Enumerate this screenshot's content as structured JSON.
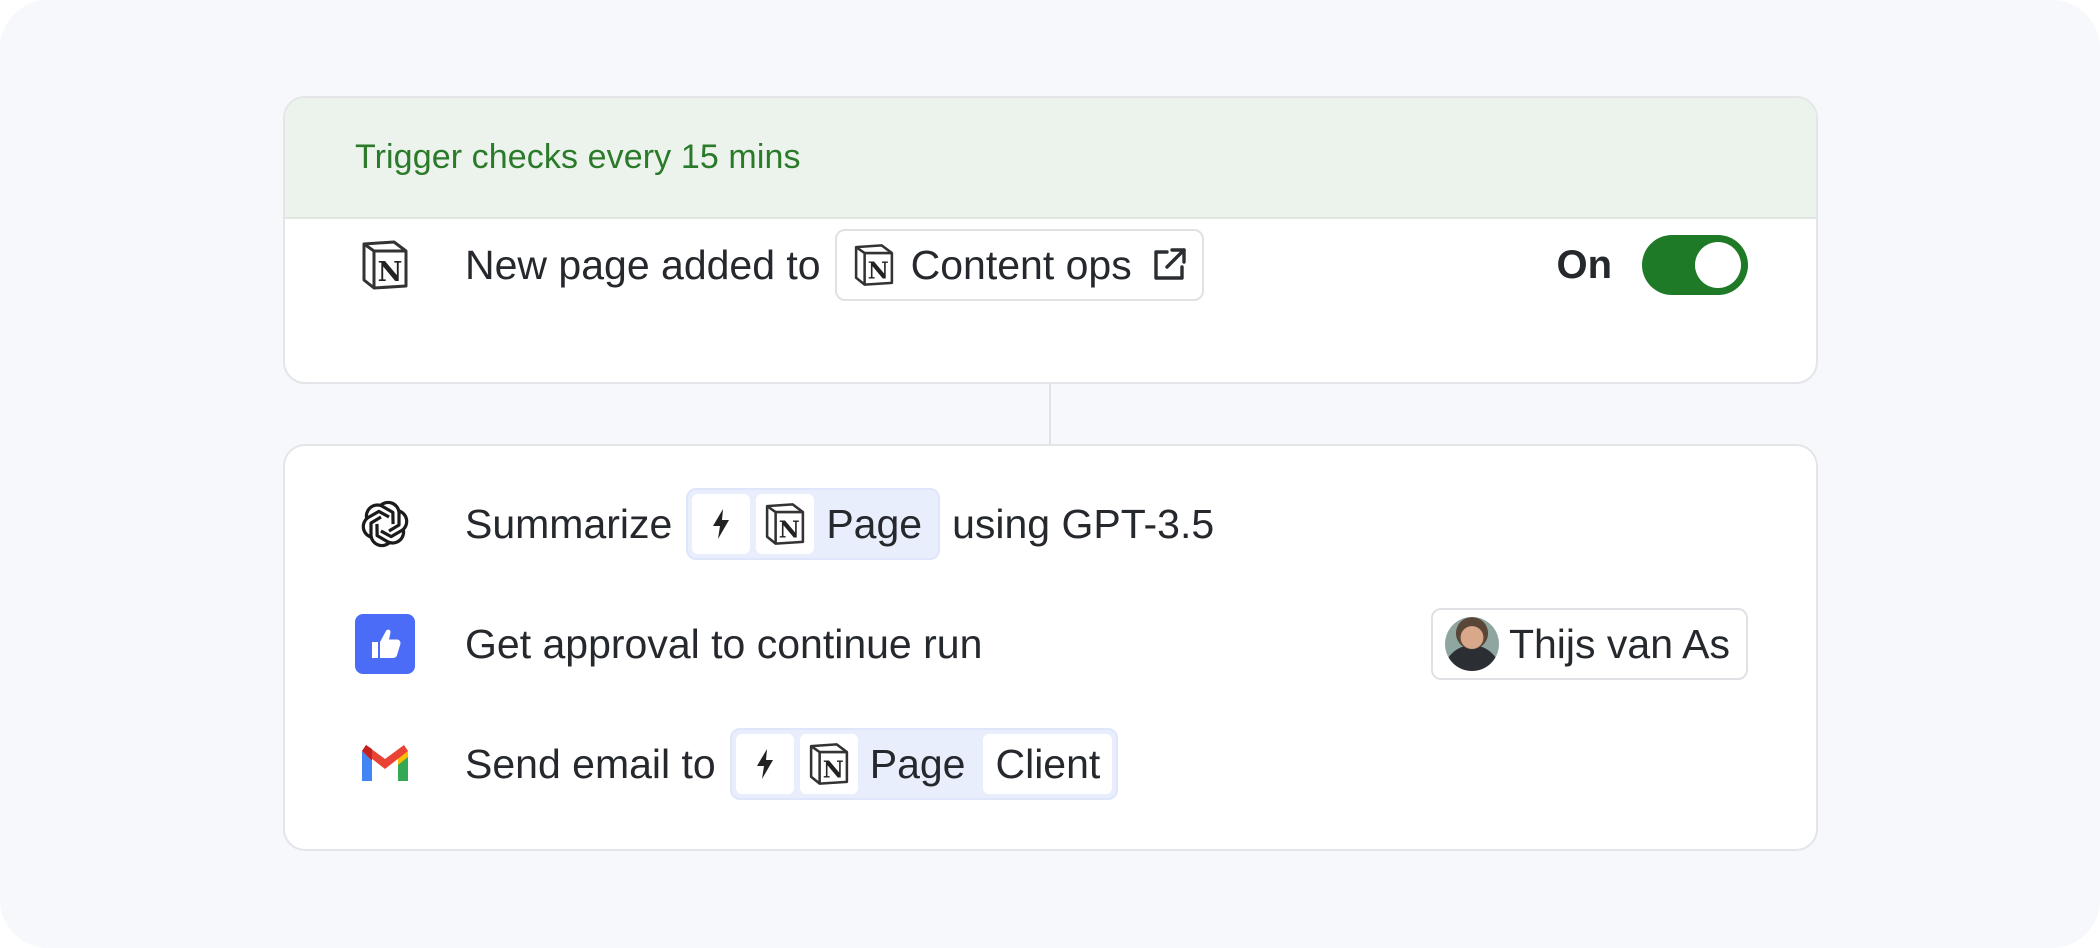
{
  "trigger": {
    "header_text": "Trigger checks every 15 mins",
    "row": {
      "icon": "notion-icon",
      "text": "New page added to",
      "chip_label": "Content ops",
      "chip_icon": "notion-icon",
      "external_icon": "external-link-icon"
    },
    "toggle": {
      "label": "On",
      "state": true,
      "color": "#1e7a26"
    }
  },
  "steps": [
    {
      "icon": "openai-icon",
      "text": "Summarize",
      "tokens": [
        "bolt-icon",
        "notion-icon"
      ],
      "token_label": "Page",
      "after_text": "using GPT-3.5"
    },
    {
      "icon": "approval-thumbs-up-icon",
      "icon_color": "#4a6cf7",
      "text": "Get approval to continue run",
      "assignee": "Thijs van As"
    },
    {
      "icon": "gmail-icon",
      "text": "Send email to",
      "tokens": [
        "bolt-icon",
        "notion-icon"
      ],
      "token_label": "Page",
      "token_field": "Client"
    }
  ],
  "colors": {
    "header_bg": "#ecf3ec",
    "header_text": "#2a7a2a",
    "token_bg": "#e9eefc"
  }
}
